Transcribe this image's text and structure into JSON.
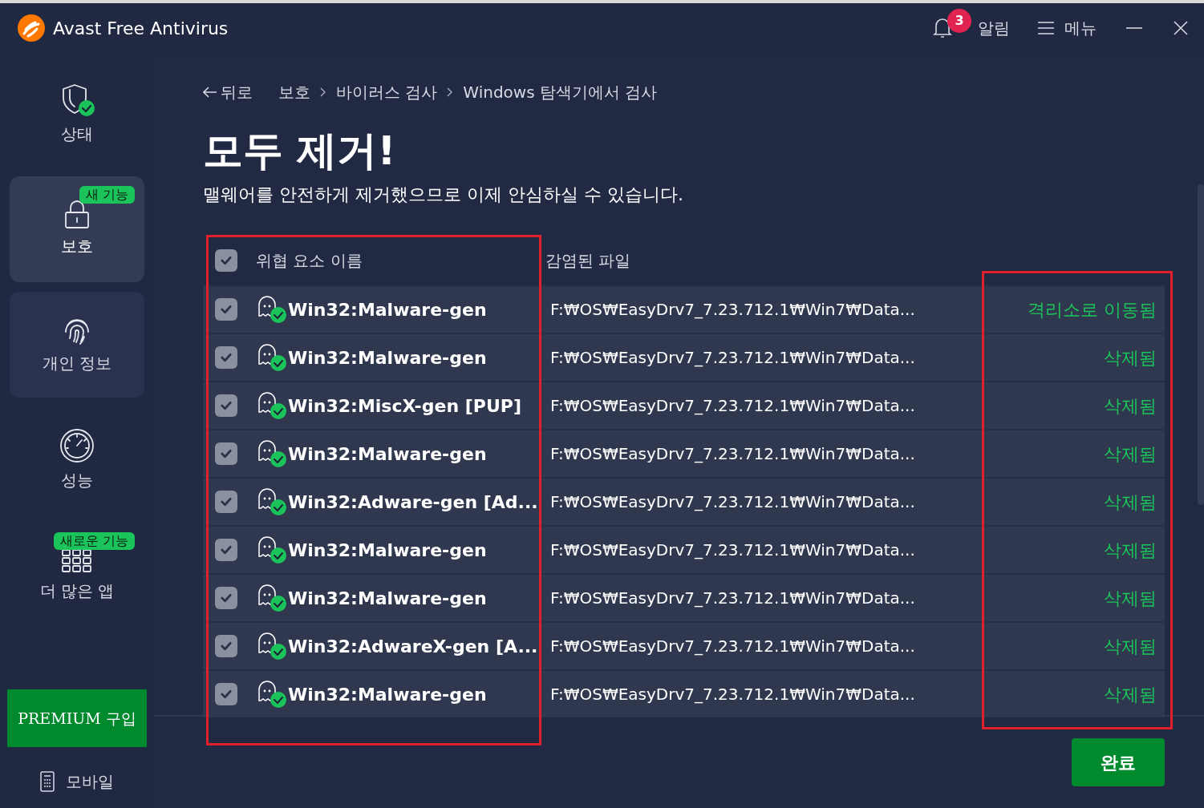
{
  "window": {
    "title": "Avast Free Antivirus"
  },
  "header": {
    "notifications": {
      "badge": "3",
      "label": "알림"
    },
    "menu": {
      "label": "메뉴"
    }
  },
  "sidebar": {
    "items": [
      {
        "kind": "status",
        "label": "상태",
        "selected": false,
        "hovered": false
      },
      {
        "kind": "lock",
        "label": "보호",
        "selected": true,
        "hovered": false,
        "badge": "새 기능"
      },
      {
        "kind": "fingerprint",
        "label": "개인 정보",
        "selected": false,
        "hovered": true
      },
      {
        "kind": "gauge",
        "label": "성능",
        "selected": false,
        "hovered": false
      },
      {
        "kind": "grid",
        "label": "더 많은 앱",
        "selected": false,
        "hovered": false,
        "badge": "새로운 기능"
      }
    ],
    "premium_button": "PREMIUM 구입",
    "mobile": "모바일"
  },
  "breadcrumb": {
    "back": "뒤로",
    "items": [
      "보호",
      "바이러스 검사",
      "Windows 탐색기에서 검사"
    ]
  },
  "heading": "모두 제거!",
  "subtitle": "맬웨어를 안전하게 제거했으므로 이제 안심하실 수 있습니다.",
  "table": {
    "select_all_checked": true,
    "columns": [
      "위협 요소 이름",
      "감염된 파일"
    ],
    "rows": [
      {
        "checked": true,
        "name": "Win32:Malware-gen",
        "file": "F:₩OS₩EasyDrv7_7.23.712.1₩Win7₩Data...",
        "status": "격리소로 이동됨"
      },
      {
        "checked": true,
        "name": "Win32:Malware-gen",
        "file": "F:₩OS₩EasyDrv7_7.23.712.1₩Win7₩Data...",
        "status": "삭제됨"
      },
      {
        "checked": true,
        "name": "Win32:MiscX-gen [PUP]",
        "file": "F:₩OS₩EasyDrv7_7.23.712.1₩Win7₩Data...",
        "status": "삭제됨"
      },
      {
        "checked": true,
        "name": "Win32:Malware-gen",
        "file": "F:₩OS₩EasyDrv7_7.23.712.1₩Win7₩Data...",
        "status": "삭제됨"
      },
      {
        "checked": true,
        "name": "Win32:Adware-gen [Ad...",
        "file": "F:₩OS₩EasyDrv7_7.23.712.1₩Win7₩Data...",
        "status": "삭제됨"
      },
      {
        "checked": true,
        "name": "Win32:Malware-gen",
        "file": "F:₩OS₩EasyDrv7_7.23.712.1₩Win7₩Data...",
        "status": "삭제됨"
      },
      {
        "checked": true,
        "name": "Win32:Malware-gen",
        "file": "F:₩OS₩EasyDrv7_7.23.712.1₩Win7₩Data...",
        "status": "삭제됨"
      },
      {
        "checked": true,
        "name": "Win32:AdwareX-gen [A...",
        "file": "F:₩OS₩EasyDrv7_7.23.712.1₩Win7₩Data...",
        "status": "삭제됨"
      },
      {
        "checked": true,
        "name": "Win32:Malware-gen",
        "file": "F:₩OS₩EasyDrv7_7.23.712.1₩Win7₩Data...",
        "status": "삭제됨"
      }
    ]
  },
  "done_button": "완료"
}
